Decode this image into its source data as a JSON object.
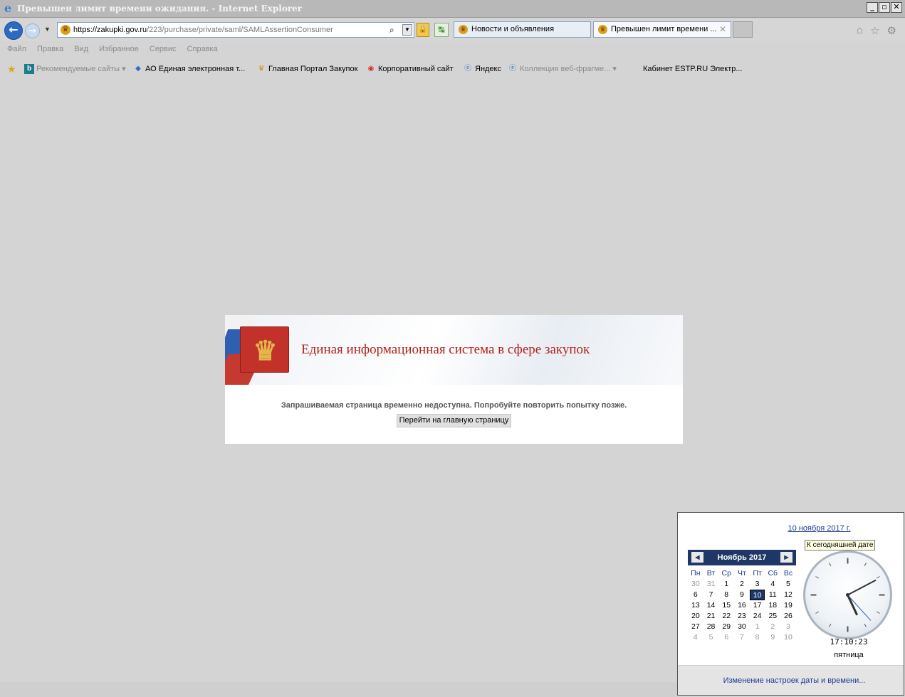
{
  "window": {
    "title": "Превышен лимит времени ожидания. - Internet Explorer",
    "minimize": "_",
    "maximize": "▫",
    "close": "✕"
  },
  "address": {
    "url_host": "https://zakupki.gov.ru",
    "url_path": "/223/purchase/private/saml/SAMLAssertionConsumer"
  },
  "tabs": [
    {
      "label": "Новости и объявления"
    },
    {
      "label": "Превышен лимит времени ..."
    }
  ],
  "menu": [
    "Файл",
    "Правка",
    "Вид",
    "Избранное",
    "Сервис",
    "Справка"
  ],
  "favorites": [
    {
      "label": "Рекомендуемые сайты ▾"
    },
    {
      "label": "АО Единая электронная т..."
    },
    {
      "label": "Главная Портал Закупок"
    },
    {
      "label": "Корпоративный сайт"
    },
    {
      "label": "Яндекс"
    },
    {
      "label": "Коллекция веб-фрагме... ▾"
    },
    {
      "label": "Кабинет ESTP.RU Электр..."
    }
  ],
  "page": {
    "system_title": "Единая информационная система в сфере закупок",
    "message": "Запрашиваемая страница временно недоступна. Попробуйте повторить попытку позже.",
    "home_button": "Перейти на главную страницу"
  },
  "clock_popup": {
    "today_link": "10 ноября 2017 г.",
    "tooltip": "К сегодняшней дате",
    "month_label": "Ноябрь 2017",
    "weekdays": [
      "Пн",
      "Вт",
      "Ср",
      "Чт",
      "Пт",
      "Сб",
      "Вс"
    ],
    "weeks": [
      [
        "30",
        "31",
        "1",
        "2",
        "3",
        "4",
        "5"
      ],
      [
        "6",
        "7",
        "8",
        "9",
        "10",
        "11",
        "12"
      ],
      [
        "13",
        "14",
        "15",
        "16",
        "17",
        "18",
        "19"
      ],
      [
        "20",
        "21",
        "22",
        "23",
        "24",
        "25",
        "26"
      ],
      [
        "27",
        "28",
        "29",
        "30",
        "1",
        "2",
        "3"
      ],
      [
        "4",
        "5",
        "6",
        "7",
        "8",
        "9",
        "10"
      ]
    ],
    "selected_day": "10",
    "time": "17:10:23",
    "clock_time": {
      "hours": 17,
      "minutes": 10,
      "seconds": 23
    },
    "weekday": "пятница",
    "settings_link": "Изменение настроек даты и времени..."
  }
}
